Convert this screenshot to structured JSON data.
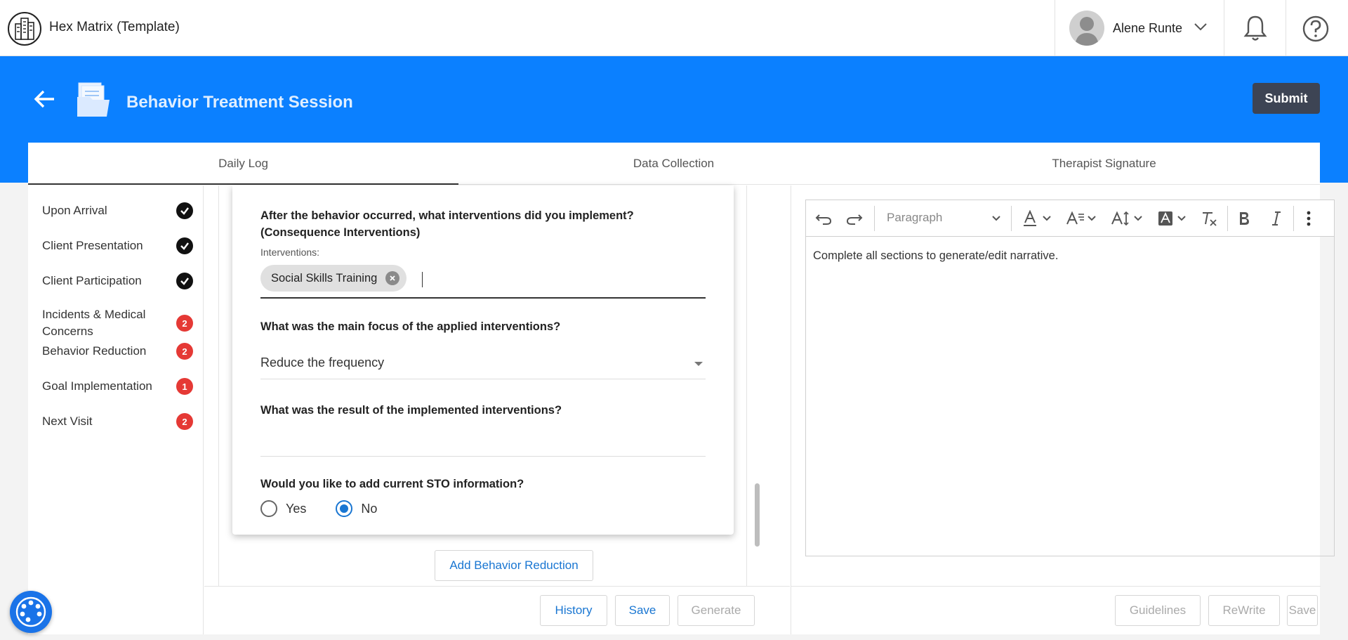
{
  "header": {
    "app_title": "Hex Matrix (Template)",
    "user_name": "Alene Runte"
  },
  "page": {
    "title": "Behavior Treatment Session",
    "submit_label": "Submit"
  },
  "tabs": [
    {
      "label": "Daily Log",
      "active": true
    },
    {
      "label": "Data Collection",
      "active": false
    },
    {
      "label": "Therapist Signature",
      "active": false
    }
  ],
  "sidebar": {
    "items": [
      {
        "label": "Upon Arrival",
        "status": "complete"
      },
      {
        "label": "Client Presentation",
        "status": "complete"
      },
      {
        "label": "Client Participation",
        "status": "complete"
      },
      {
        "label": "Incidents & Medical Concerns",
        "status": "badge",
        "count": "2"
      },
      {
        "label": "Behavior Reduction",
        "status": "badge",
        "count": "2"
      },
      {
        "label": "Goal Implementation",
        "status": "badge",
        "count": "1"
      },
      {
        "label": "Next Visit",
        "status": "badge",
        "count": "2"
      }
    ]
  },
  "form": {
    "q_interventions": "After the behavior occurred, what interventions did you implement? (Consequence Interventions)",
    "interventions_label": "Interventions:",
    "chip": "Social Skills Training",
    "q_focus": "What was the main focus of the applied interventions?",
    "focus_value": "Reduce the frequency",
    "q_result": "What was the result of the implemented interventions?",
    "q_sto": "Would you like to add current STO information?",
    "radio_yes": "Yes",
    "radio_no": "No",
    "sto_selected": "No",
    "add_button": "Add Behavior Reduction"
  },
  "middle_actions": {
    "history": "History",
    "save": "Save",
    "generate": "Generate"
  },
  "editor": {
    "paragraph": "Paragraph",
    "placeholder_text": "Complete all sections to generate/edit narrative."
  },
  "right_actions": {
    "guidelines": "Guidelines",
    "rewrite": "ReWrite",
    "save": "Save"
  },
  "colors": {
    "brand_blue": "#0b80ff",
    "submit_bg": "#3d4454",
    "badge_red": "#e53935",
    "link_blue": "#1976d2"
  }
}
